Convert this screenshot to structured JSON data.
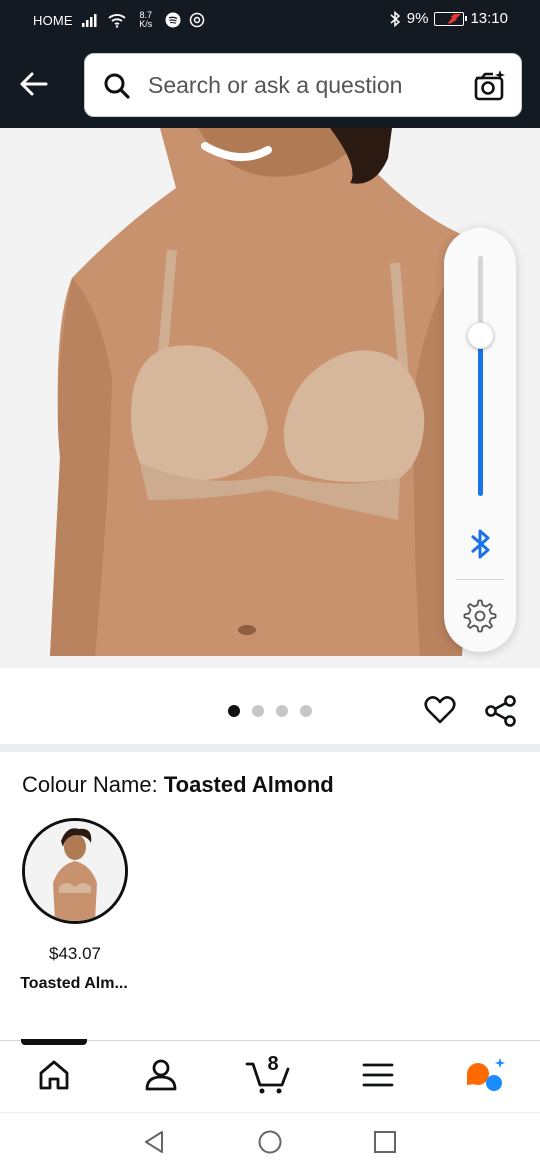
{
  "status_bar": {
    "carrier": "HOME",
    "speed_value": "8.7",
    "speed_unit": "K/s",
    "battery_percent": "9%",
    "time": "13:10"
  },
  "header": {
    "search_placeholder": "Search or ask a question"
  },
  "carousel": {
    "total_images": 4,
    "active_index": 0
  },
  "volume_overlay": {
    "level": 0.67
  },
  "product": {
    "colour_label": "Colour Name:",
    "colour_value": "Toasted Almond",
    "swatches": [
      {
        "price": "$43.07",
        "name": "Toasted Alm..."
      }
    ]
  },
  "bottom_nav": {
    "cart_count": "8",
    "items": [
      "home-icon",
      "account-icon",
      "cart-icon",
      "menu-icon",
      "rufus-icon"
    ]
  },
  "colors": {
    "header_bg": "#131a22",
    "accent_blue": "#1a73e8",
    "rufus_orange": "#ff6a00",
    "rufus_blue": "#1a8cff"
  }
}
